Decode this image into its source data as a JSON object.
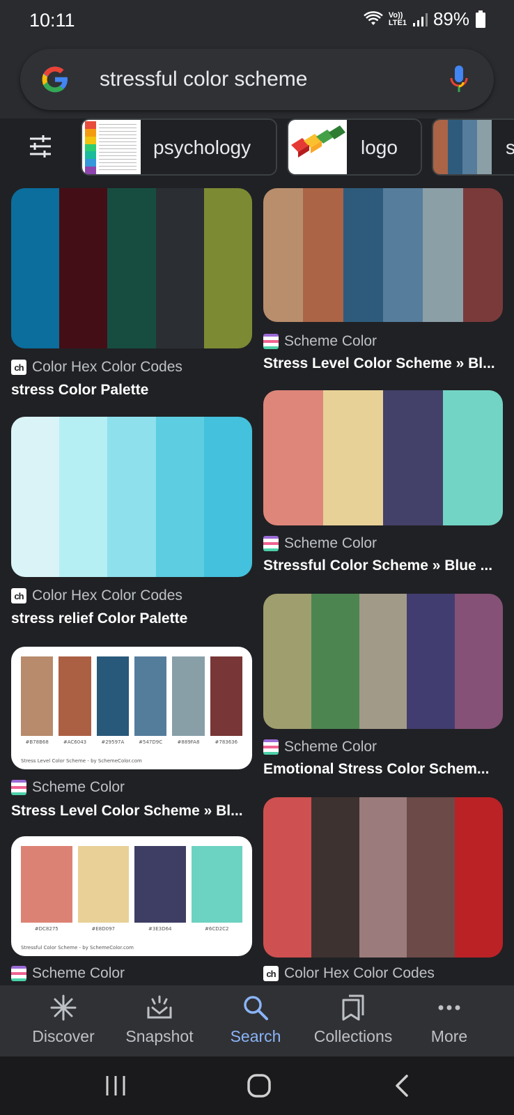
{
  "status": {
    "time": "10:11",
    "battery": "89%",
    "volte_top": "Vo))",
    "volte_bottom": "LTE1"
  },
  "search": {
    "query": "stressful color scheme"
  },
  "chips": [
    {
      "label": "psychology"
    },
    {
      "label": "logo"
    },
    {
      "label": "s"
    }
  ],
  "results": {
    "left": [
      {
        "source": "Color Hex Color Codes",
        "favicon": "ch-icon",
        "title": "stress Color Palette",
        "colors": [
          "#0b6e9c",
          "#440e16",
          "#174d41",
          "#2b2f33",
          "#7c8b33"
        ]
      },
      {
        "source": "Color Hex Color Codes",
        "favicon": "ch-icon",
        "title": "stress relief Color Palette",
        "colors": [
          "#d9f3f7",
          "#b5eff3",
          "#8de0ec",
          "#5dcde1",
          "#44c1dc"
        ]
      },
      {
        "source": "Scheme Color",
        "favicon": "schemecolor-icon",
        "title": "Stress Level Color Scheme » Bl...",
        "colors": [
          "#B78B6B",
          "#AC6043",
          "#29597A",
          "#547D9C",
          "#889FA8",
          "#783636"
        ],
        "hex_labels": [
          "#B78B68",
          "#AC6043",
          "#29597A",
          "#547D9C",
          "#889FA8",
          "#783636"
        ],
        "caption": "Stress Level  Color Scheme - by SchemeColor.com"
      },
      {
        "source": "Scheme Color",
        "favicon": "schemecolor-icon",
        "title": "",
        "colors": [
          "#DC8275",
          "#E8D097",
          "#3E3D64",
          "#6CD2C2"
        ],
        "hex_labels": [
          "#DC8275",
          "#E8D097",
          "#3E3D64",
          "#6CD2C2"
        ],
        "caption": "Stressful Color Scheme - by SchemeColor.com"
      }
    ],
    "right": [
      {
        "source": "Scheme Color",
        "favicon": "schemecolor-icon",
        "title": "Stress Level Color Scheme » Bl...",
        "colors": [
          "#b98e6d",
          "#ab6446",
          "#2e5b7c",
          "#567d9c",
          "#8b9fa7",
          "#7a3a3a"
        ]
      },
      {
        "source": "Scheme Color",
        "favicon": "schemecolor-icon",
        "title": "Stressful Color Scheme » Blue ...",
        "colors": [
          "#df867a",
          "#e8d196",
          "#43416a",
          "#72d4c4"
        ]
      },
      {
        "source": "Scheme Color",
        "favicon": "schemecolor-icon",
        "title": "Emotional Stress Color Schem...",
        "colors": [
          "#9f9e6e",
          "#4d8551",
          "#a19a88",
          "#423d70",
          "#855176"
        ]
      },
      {
        "source": "Color Hex Color Codes",
        "favicon": "ch-icon",
        "title": "",
        "colors": [
          "#cf5050",
          "#3e3230",
          "#9b7b7b",
          "#6b4a47",
          "#bb2226"
        ]
      }
    ]
  },
  "bottom_nav": [
    {
      "label": "Discover",
      "icon": "asterisk-icon",
      "active": false
    },
    {
      "label": "Snapshot",
      "icon": "snapshot-icon",
      "active": false
    },
    {
      "label": "Search",
      "icon": "search-icon",
      "active": true
    },
    {
      "label": "Collections",
      "icon": "collections-icon",
      "active": false
    },
    {
      "label": "More",
      "icon": "more-icon",
      "active": false
    }
  ],
  "colors": {
    "background": "#202124",
    "accent": "#8ab4f8",
    "text": "#e8eaed",
    "muted": "#bdc1c6"
  }
}
